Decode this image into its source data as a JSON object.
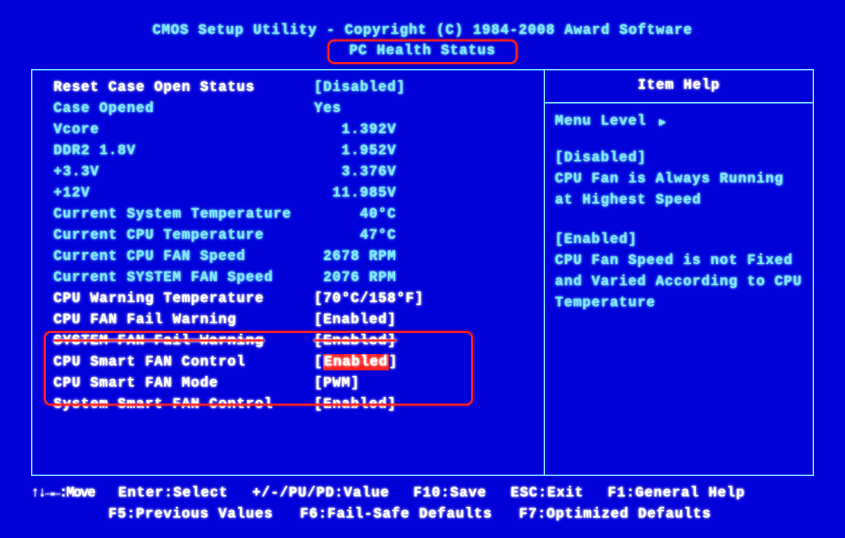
{
  "header": {
    "title": "CMOS Setup Utility - Copyright (C) 1984-2008 Award Software",
    "page": "PC Health Status"
  },
  "settings": [
    {
      "label": "Reset Case Open Status",
      "value": "Disabled",
      "bracket": true,
      "editable": true,
      "labelColor": "white",
      "valColor": "cyan"
    },
    {
      "label": "Case Opened",
      "value": "Yes",
      "bracket": false,
      "editable": false,
      "labelColor": "cyan",
      "valColor": "cyan"
    },
    {
      "label": "Vcore",
      "value": "1.392V",
      "bracket": false,
      "editable": false,
      "labelColor": "cyan",
      "valColor": "cyan"
    },
    {
      "label": "DDR2 1.8V",
      "value": "1.952V",
      "bracket": false,
      "editable": false,
      "labelColor": "cyan",
      "valColor": "cyan"
    },
    {
      "label": "+3.3V",
      "value": "3.376V",
      "bracket": false,
      "editable": false,
      "labelColor": "cyan",
      "valColor": "cyan"
    },
    {
      "label": "+12V",
      "value": "11.985V",
      "bracket": false,
      "editable": false,
      "labelColor": "cyan",
      "valColor": "cyan"
    },
    {
      "label": "Current System Temperature",
      "value": "40°C",
      "bracket": false,
      "editable": false,
      "labelColor": "cyan",
      "valColor": "cyan"
    },
    {
      "label": "Current CPU Temperature",
      "value": "47°C",
      "bracket": false,
      "editable": false,
      "labelColor": "cyan",
      "valColor": "cyan"
    },
    {
      "label": "Current CPU FAN Speed",
      "value": "2678 RPM",
      "bracket": false,
      "editable": false,
      "labelColor": "cyan",
      "valColor": "cyan"
    },
    {
      "label": "Current SYSTEM FAN Speed",
      "value": "2076 RPM",
      "bracket": false,
      "editable": false,
      "labelColor": "cyan",
      "valColor": "cyan"
    },
    {
      "label": "CPU Warning Temperature",
      "value": "70°C/158°F",
      "bracket": true,
      "editable": true,
      "labelColor": "white",
      "valColor": "white"
    },
    {
      "label": "CPU FAN Fail Warning",
      "value": "Enabled",
      "bracket": true,
      "editable": true,
      "labelColor": "white",
      "valColor": "white"
    },
    {
      "label": "SYSTEM FAN Fail Warning",
      "value": "Enabled",
      "bracket": true,
      "editable": true,
      "labelColor": "white",
      "valColor": "white",
      "strike": true
    },
    {
      "label": "CPU Smart FAN Control",
      "value": "Enabled",
      "bracket": true,
      "editable": true,
      "labelColor": "white",
      "valColor": "white",
      "selected": true
    },
    {
      "label": "CPU Smart FAN Mode",
      "value": "PWM",
      "bracket": true,
      "editable": true,
      "labelColor": "white",
      "valColor": "white"
    },
    {
      "label": "System Smart FAN Control",
      "value": "Enabled",
      "bracket": true,
      "editable": true,
      "labelColor": "white",
      "valColor": "white"
    }
  ],
  "help": {
    "title": "Item Help",
    "menuLevel": "Menu Level",
    "blocks": [
      {
        "heading": "[Disabled]",
        "text": "CPU Fan is Always Running at Highest Speed"
      },
      {
        "heading": "[Enabled]",
        "text": "CPU Fan Speed is not Fixed and Varied According to CPU Temperature"
      }
    ]
  },
  "footer": {
    "l1a": "↑↓→←:Move",
    "l1b": "Enter:Select",
    "l1c": "+/-/PU/PD:Value",
    "l1d": "F10:Save",
    "l1e": "ESC:Exit",
    "l1f": "F1:General Help",
    "l2a": "F5:Previous Values",
    "l2b": "F6:Fail-Safe Defaults",
    "l2c": "F7:Optimized Defaults"
  }
}
